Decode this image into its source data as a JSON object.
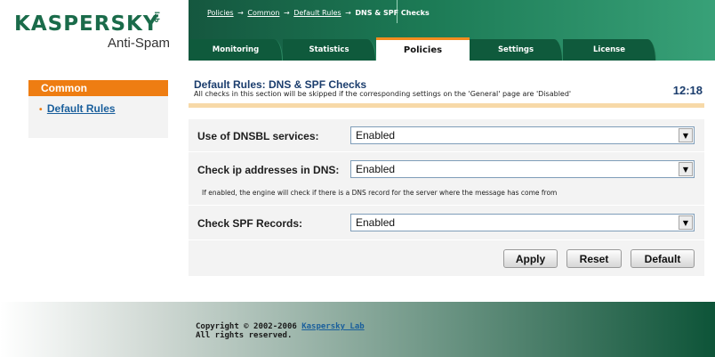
{
  "header": {
    "brand": "KASPERSKY",
    "brand_tag": "lab",
    "product": "Anti-Spam",
    "breadcrumb": {
      "items": [
        "Policies",
        "Common",
        "Default Rules"
      ],
      "current": "DNS & SPF Checks",
      "separator": "→"
    },
    "tabs": [
      {
        "label": "Monitoring",
        "active": false
      },
      {
        "label": "Statistics",
        "active": false
      },
      {
        "label": "Policies",
        "active": true
      },
      {
        "label": "Settings",
        "active": false
      },
      {
        "label": "License",
        "active": false
      }
    ]
  },
  "sidebar": {
    "section": "Common",
    "items": [
      {
        "label": "Default Rules",
        "bullet": "•"
      }
    ]
  },
  "content": {
    "title": "Default Rules: DNS & SPF Checks",
    "subtitle": "All checks in this section will be skipped if the corresponding settings on the 'General' page are 'Disabled'",
    "time": "12:18",
    "settings": [
      {
        "label": "Use of DNSBL services:",
        "value": "Enabled"
      },
      {
        "label": "Check ip addresses in DNS:",
        "value": "Enabled",
        "hint": "If enabled, the engine will check if there is a DNS record for the server where the message has come from"
      },
      {
        "label": "Check SPF Records:",
        "value": "Enabled"
      }
    ],
    "buttons": {
      "apply": "Apply",
      "reset": "Reset",
      "default": "Default"
    }
  },
  "footer": {
    "copyright": "Copyright © 2002-2006",
    "company_link": "Kaspersky Lab",
    "rights": "All rights reserved."
  },
  "colors": {
    "brand_green": "#1a6b4a",
    "accent_orange": "#ee7d12",
    "title_blue": "#1b3d6d"
  }
}
